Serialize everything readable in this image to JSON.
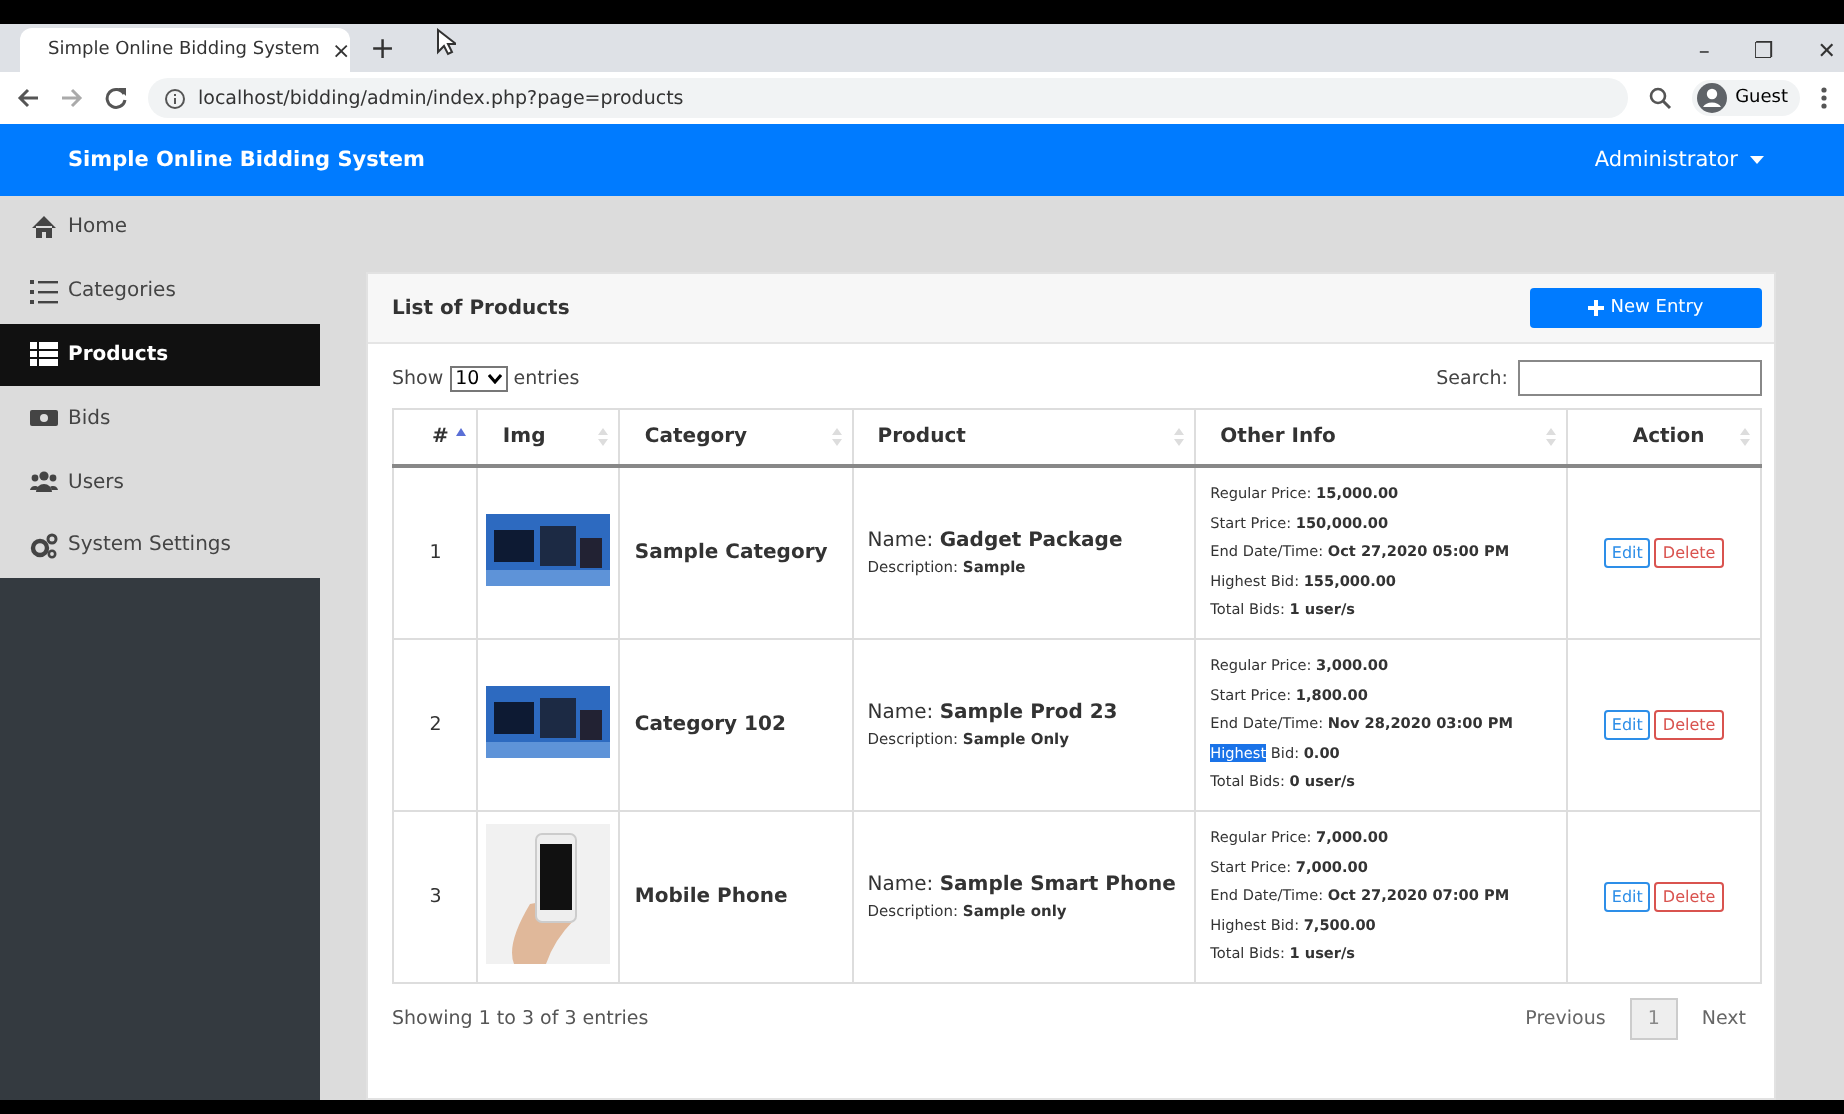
{
  "browser": {
    "tab_title": "Simple Online Bidding System",
    "tab_close": "×",
    "new_tab": "+",
    "url": "localhost/bidding/admin/index.php?page=products",
    "profile": "Guest",
    "window_controls": [
      "–",
      "❐",
      "✕"
    ]
  },
  "navbar": {
    "brand": "Simple Online Bidding System",
    "user": "Administrator"
  },
  "sidebar": {
    "items": [
      {
        "label": "Home",
        "kind": "home",
        "selected": false
      },
      {
        "label": "Categories",
        "kind": "list",
        "selected": false
      },
      {
        "label": "Products",
        "kind": "table",
        "selected": true
      },
      {
        "label": "Bids",
        "kind": "money",
        "selected": false
      },
      {
        "label": "Users",
        "kind": "users",
        "selected": false
      },
      {
        "label": "System Settings",
        "kind": "gears",
        "selected": false
      }
    ]
  },
  "card": {
    "title": "List of Products",
    "new_button": "New Entry",
    "length_label_before": "Show",
    "length_value": "10",
    "length_label_after": "entries",
    "search_label": "Search:",
    "table": {
      "columns": [
        "#",
        "Img",
        "Category",
        "Product",
        "Other Info",
        "Action"
      ],
      "rows": [
        {
          "number": "1",
          "kind": "gadgets",
          "category": "Sample Category",
          "name": "Name: **Gadget Package**",
          "description": "Description: **Sample**",
          "info": [
            {
              "text": "Regular Price: **15,000.00**"
            },
            {
              "text": "Start Price: **150,000.00**"
            },
            {
              "text": "End Date/Time: **Oct 27,2020 05:00 PM**"
            },
            {
              "text": "Highest Bid: **155,000.00**"
            },
            {
              "text": "Total Bids: **1 user/s**"
            }
          ],
          "actions": [
            "Edit",
            "Delete"
          ]
        },
        {
          "number": "2",
          "kind": "gadgets",
          "category": "Category 102",
          "name": "Name: **Sample Prod 23**",
          "description": "Description: **Sample Only**",
          "info": [
            {
              "text": "Regular Price: **3,000.00**"
            },
            {
              "text": "Start Price: **1,800.00**"
            },
            {
              "text": "End Date/Time: **Nov 28,2020 03:00 PM**"
            },
            {
              "selection": "Highest",
              "text": " Bid: **0.00**"
            },
            {
              "text": "Total Bids: **0 user/s**"
            }
          ],
          "actions": [
            "Edit",
            "Delete"
          ]
        },
        {
          "number": "3",
          "kind": "phone",
          "category": "Mobile Phone",
          "name": "Name: **Sample Smart Phone**",
          "description": "Description: **Sample only**",
          "info": [
            {
              "text": "Regular Price: **7,000.00**"
            },
            {
              "text": "Start Price: **7,000.00**"
            },
            {
              "text": "End Date/Time: **Oct 27,2020 07:00 PM**"
            },
            {
              "text": "Highest Bid: **7,500.00**"
            },
            {
              "text": "Total Bids: **1 user/s**"
            }
          ],
          "actions": [
            "Edit",
            "Delete"
          ]
        }
      ]
    },
    "footer_info": "Showing 1 to 3 of 3 entries",
    "pagination": [
      {
        "label": "Previous",
        "kind": "prev",
        "selected": false
      },
      {
        "label": "1",
        "kind": "page",
        "selected": true
      },
      {
        "label": "Next",
        "kind": "next",
        "selected": false
      }
    ]
  }
}
